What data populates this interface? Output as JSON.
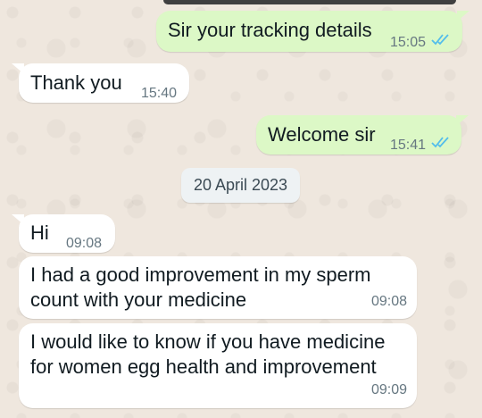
{
  "chat": {
    "messages": [
      {
        "id": "m1",
        "direction": "outgoing",
        "text": "Sir your tracking details",
        "time": "15:05",
        "status": "read"
      },
      {
        "id": "m2",
        "direction": "incoming",
        "text": "Thank you",
        "time": "15:40"
      },
      {
        "id": "m3",
        "direction": "outgoing",
        "text": "Welcome sir",
        "time": "15:41",
        "status": "read"
      },
      {
        "id": "m4",
        "direction": "incoming",
        "text": "Hi",
        "time": "09:08"
      },
      {
        "id": "m5",
        "direction": "incoming",
        "text": "I had a good improvement in my sperm count with your medicine",
        "time": "09:08"
      },
      {
        "id": "m6",
        "direction": "incoming",
        "text": "I would like to know if you have medicine for women egg health and improvement",
        "time": "09:09"
      }
    ],
    "date_separator": "20 April 2023"
  },
  "colors": {
    "outgoing_bubble": "#dcf8c6",
    "incoming_bubble": "#ffffff",
    "read_tick": "#53bdeb",
    "background": "#efe7de"
  },
  "icons": {
    "read_receipt": "double-check-icon"
  }
}
